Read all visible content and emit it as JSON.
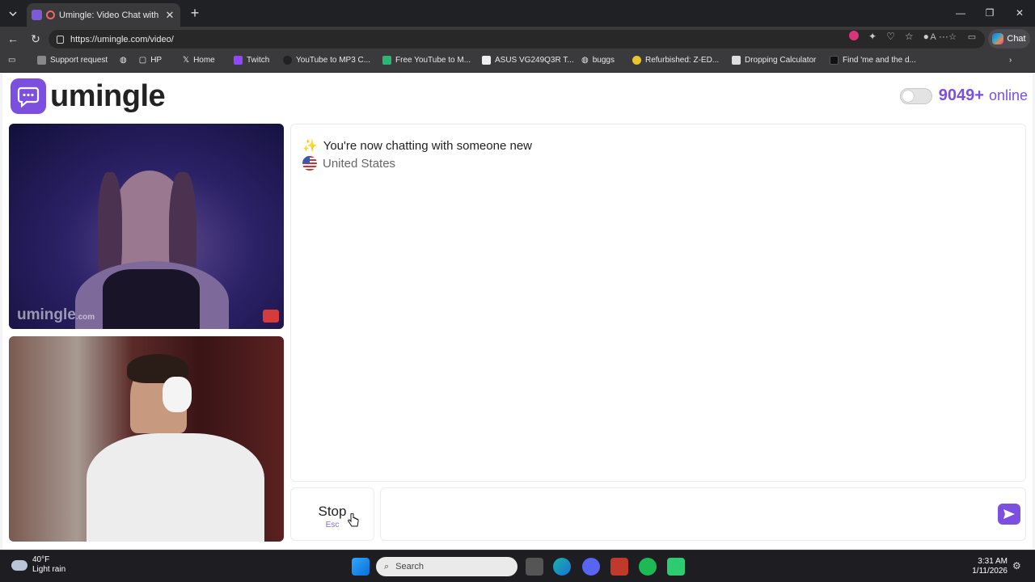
{
  "browser": {
    "tab_title": "Umingle: Video Chat with Stra",
    "url": "https://umingle.com/video/",
    "chat_button_label": "Chat",
    "bookmarks": [
      {
        "label": "Support request"
      },
      {
        "label": "HP"
      },
      {
        "label": "Home"
      },
      {
        "label": "Twitch"
      },
      {
        "label": "YouTube to MP3 C..."
      },
      {
        "label": "Free YouTube to M..."
      },
      {
        "label": "ASUS VG249Q3R T..."
      },
      {
        "label": "buggs"
      },
      {
        "label": "Refurbished: Z-ED..."
      },
      {
        "label": "Dropping Calculator"
      },
      {
        "label": "Find 'me and the d..."
      }
    ]
  },
  "site": {
    "logo_text": "umingle",
    "online_count": "9049+",
    "online_label": "online",
    "accent_color": "#7c4fe0"
  },
  "videos": {
    "watermark": "umingle",
    "watermark_suffix": ".com"
  },
  "chat": {
    "status_message": "You're now chatting with someone new",
    "country": "United States"
  },
  "controls": {
    "stop_label": "Stop",
    "stop_shortcut": "Esc",
    "message_placeholder": ""
  },
  "taskbar": {
    "temperature": "40°F",
    "condition": "Light rain",
    "search_placeholder": "Search",
    "time": "3:31 AM",
    "date": "1/11/2026"
  }
}
